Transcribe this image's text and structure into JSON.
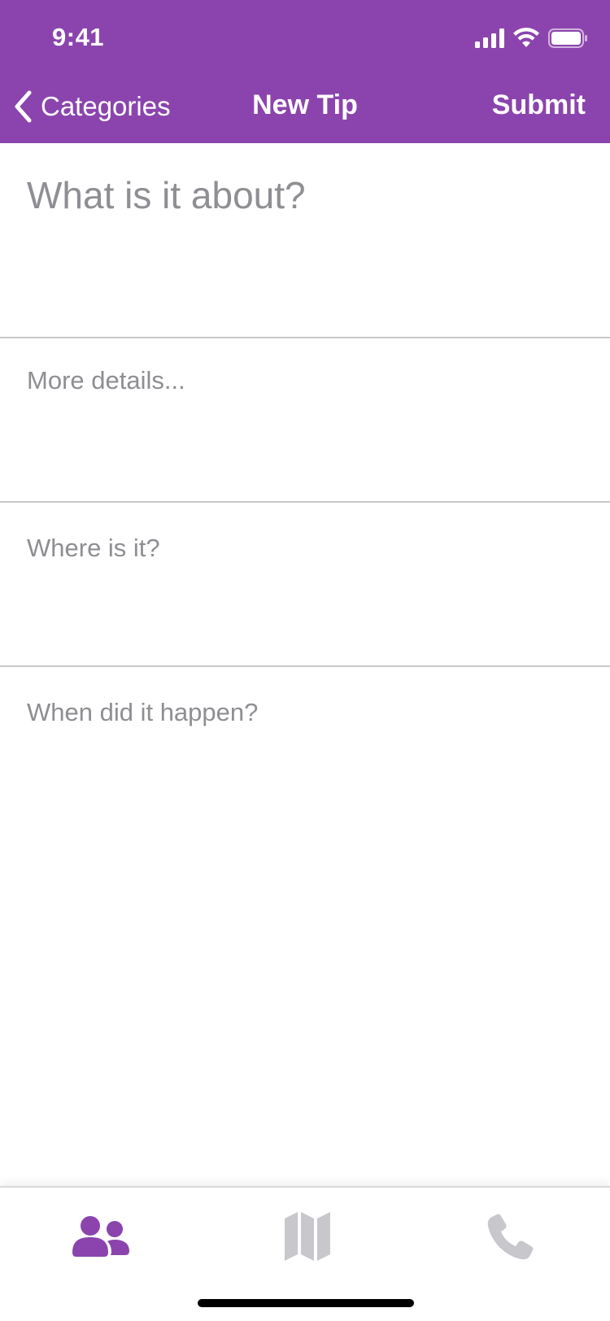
{
  "status_bar": {
    "time": "9:41",
    "icons": [
      "cellular-signal-icon",
      "wifi-icon",
      "battery-icon"
    ]
  },
  "nav": {
    "back_label": "Categories",
    "title": "New Tip",
    "submit_label": "Submit"
  },
  "form": {
    "subject": {
      "placeholder": "What is it about?",
      "value": ""
    },
    "details": {
      "placeholder": "More details...",
      "value": ""
    },
    "location": {
      "placeholder": "Where is it?",
      "value": ""
    },
    "time": {
      "placeholder": "When did it happen?",
      "value": ""
    }
  },
  "tab_bar": {
    "tabs": [
      {
        "icon": "people-icon",
        "active": true
      },
      {
        "icon": "map-icon",
        "active": false
      },
      {
        "icon": "phone-icon",
        "active": false
      }
    ]
  },
  "colors": {
    "brand": "#8b44ad",
    "inactive_icon": "#c7c7cc",
    "placeholder": "#8e8e93",
    "divider": "#c8c8cc"
  }
}
